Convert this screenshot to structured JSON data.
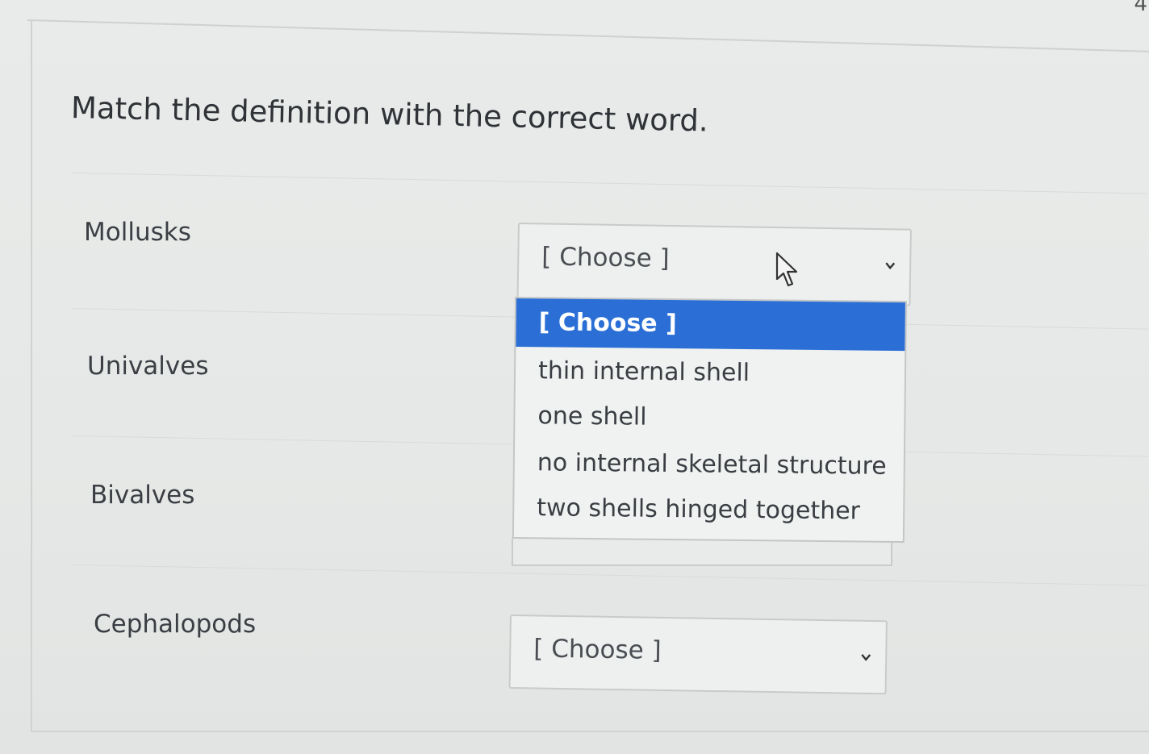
{
  "corner_text": "4",
  "question": "Match the definition with the correct word.",
  "terms": [
    "Mollusks",
    "Univalves",
    "Bivalves",
    "Cephalopods"
  ],
  "selects": {
    "mollusks": {
      "value": "[ Choose ]",
      "open": true
    },
    "cephalopods": {
      "value": "[ Choose ]",
      "open": false
    }
  },
  "dropdown_options": [
    "[ Choose ]",
    "thin internal shell",
    "one shell",
    "no internal skeletal structure",
    "two shells hinged together"
  ],
  "highlighted_option": "[ Choose ]",
  "colors": {
    "highlight": "#2b6fd6",
    "text": "#3a3d40",
    "background": "#e6e8e7"
  },
  "icons": [
    "chevron-down-icon",
    "mouse-pointer-icon"
  ]
}
